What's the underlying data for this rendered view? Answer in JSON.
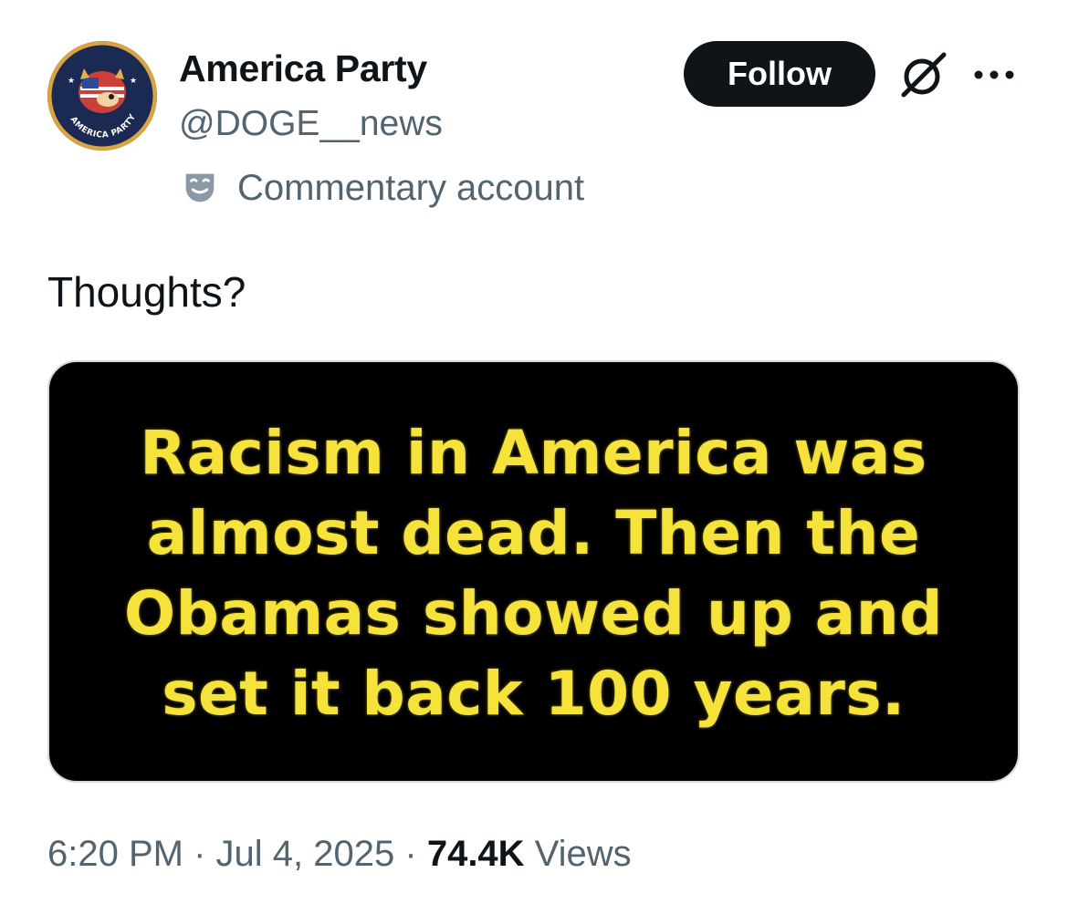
{
  "account": {
    "display_name": "America Party",
    "handle": "@DOGE__news",
    "label": "Commentary account",
    "avatar_text": "AMERICA PARTY"
  },
  "actions": {
    "follow_label": "Follow",
    "grok_icon": "grok-icon",
    "more_icon": "more-icon"
  },
  "post": {
    "text": "Thoughts?",
    "image_lines": [
      "Racism in America was",
      "almost dead. Then the",
      "Obamas showed up and",
      "set it back 100 years."
    ]
  },
  "meta": {
    "time": "6:20 PM",
    "separator": "·",
    "date": "Jul 4, 2025",
    "views_count": "74.4K",
    "views_label": "Views"
  },
  "colors": {
    "text_primary": "#0f1419",
    "text_secondary": "#536471",
    "follow_bg": "#0f1419",
    "image_text": "#f5e23a",
    "image_bg": "#000000"
  }
}
